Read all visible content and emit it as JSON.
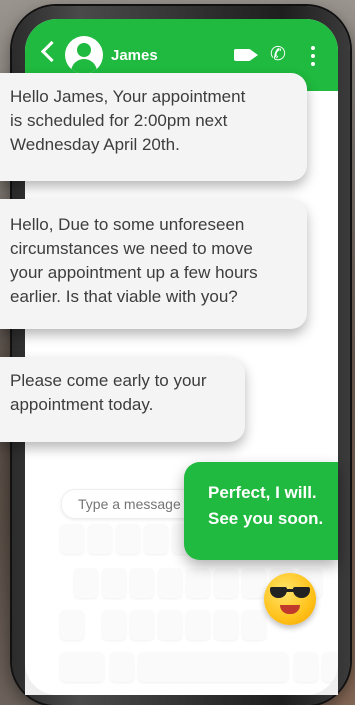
{
  "header": {
    "contact_name": "James",
    "icons": [
      "back-arrow-icon",
      "avatar-icon",
      "video-call-icon",
      "phone-call-icon",
      "more-options-icon"
    ],
    "color": "#1fba3f"
  },
  "messages": [
    {
      "direction": "incoming",
      "text": "Hello James, Your appointment\nis scheduled for 2:00pm next\nWednesday April 20th."
    },
    {
      "direction": "incoming",
      "text": "Hello, Due to some unforeseen\ncircumstances we need to move\nyour appointment up a few hours\nearlier. Is that viable with you?"
    },
    {
      "direction": "incoming",
      "text": "Please come early to your\nappointment today."
    },
    {
      "direction": "outgoing",
      "text": "Perfect, I will.\nSee you soon."
    }
  ],
  "composer": {
    "placeholder": "Type a message"
  },
  "emoji": "sunglasses-emoji",
  "colors": {
    "accent": "#1fba3f",
    "incoming_bubble": "#f4f4f4"
  }
}
